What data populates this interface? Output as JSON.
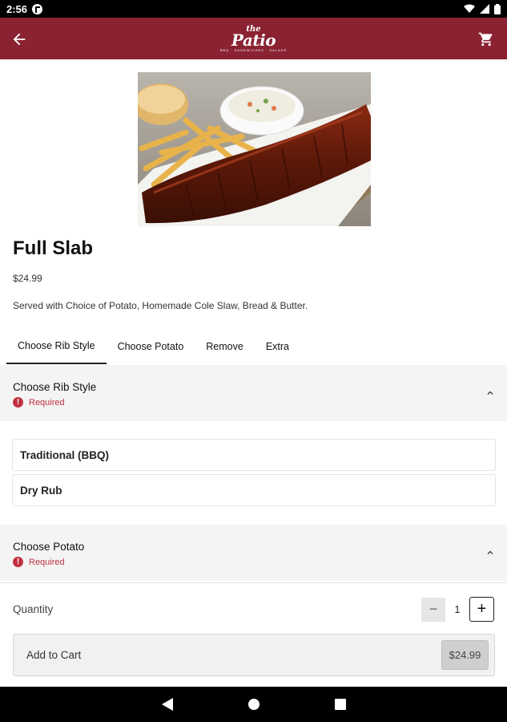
{
  "status_bar": {
    "time": "2:56"
  },
  "product": {
    "title": "Full Slab",
    "price": "$24.99",
    "description": "Served with Choice of Potato, Homemade Cole Slaw, Bread & Butter."
  },
  "tabs": [
    {
      "label": "Choose Rib Style",
      "active": true
    },
    {
      "label": "Choose Potato",
      "active": false
    },
    {
      "label": "Remove",
      "active": false
    },
    {
      "label": "Extra",
      "active": false
    }
  ],
  "sections": [
    {
      "title": "Choose Rib Style",
      "required_label": "Required",
      "options": [
        "Traditional (BBQ)",
        "Dry Rub"
      ]
    },
    {
      "title": "Choose Potato",
      "required_label": "Required"
    }
  ],
  "quantity": {
    "label": "Quantity",
    "value": "1"
  },
  "add_to_cart": {
    "label": "Add to Cart",
    "price": "$24.99"
  },
  "colors": {
    "brand": "#8a2232",
    "required": "#c0303f"
  }
}
